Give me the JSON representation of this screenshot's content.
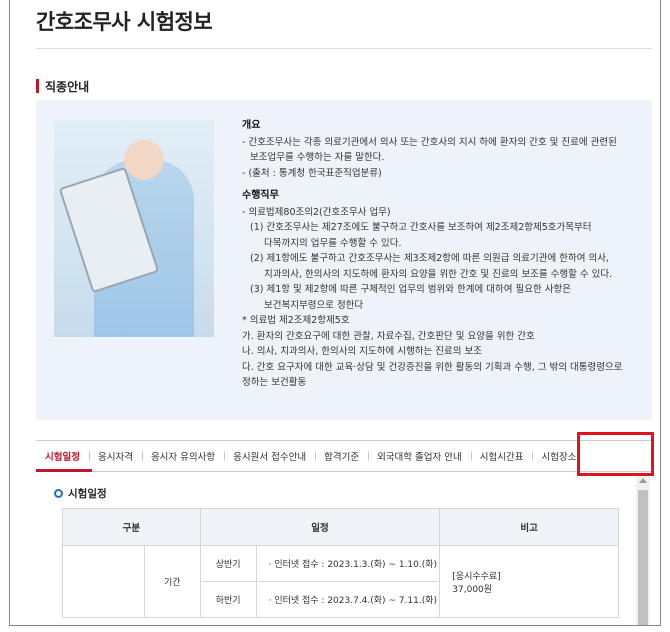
{
  "page": {
    "title": "간호조무사 시험정보"
  },
  "section": {
    "title": "직종안내"
  },
  "info": {
    "overview_heading": "개요",
    "overview_line1": "- 간호조무사는 각종 의료기관에서 의사 또는 간호사의 지시 하에 환자의 간호 및 진료에 관련된",
    "overview_line2": "보조업무를 수행하는 자를 말한다.",
    "source": "- (출처 : 통계청 한국표준직업분류)",
    "duties_heading": "수행직무",
    "law": "- 의료법제80조의2(간호조무사 업무)",
    "d1a": "(1) 간호조무사는 제27조에도 불구하고 간호사를 보조하여 제2조제2항제5호가목부터",
    "d1b": "다목까지의 업무를 수행할 수 있다.",
    "d2a": "(2) 제1항에도 불구하고 간호조무사는 제3조제2항에 따른 의원급 의료기관에 한하여 의사,",
    "d2b": "치과의사, 한의사의 지도하에 환자의 요양을 위한 간호 및 진료의 보조를 수행할 수 있다.",
    "d3a": "(3) 제1항 및 제2항에 따른 구체적인 업무의 범위와 한계에 대하여 필요한 사항은",
    "d3b": "보건복지부령으로 정한다",
    "note": "* 의료법 제2조제2항제5호",
    "na": "가. 환자의 간호요구에 대한 관찰, 자료수집, 간호판단 및 요양을 위한 간호",
    "nb": "나. 의사, 치과의사, 한의사의 지도하에 시행하는 진료의 보조",
    "nc1": "다. 간호 요구자에 대한 교육·상담 및 건강증진을 위한 활동의 기획과 수행, 그 밖의 대통령령으로",
    "nc2": "정하는 보건활동"
  },
  "tabs": [
    "시험일정",
    "응시자격",
    "응시자 유의사항",
    "응시원서 접수안내",
    "합격기준",
    "외국대학 졸업자 안내",
    "시험시간표",
    "시험장소"
  ],
  "schedule": {
    "title": "시험일정",
    "headers": [
      "구분",
      "일정",
      "비고"
    ],
    "period_label": "기간",
    "rows": [
      {
        "half": "상반기",
        "text": "· 인터넷 접수 : 2023.1.3.(화) ~ 1.10.(화)"
      },
      {
        "half": "하반기",
        "text": "· 인터넷 접수 : 2023.7.4.(화) ~ 7.11.(화)"
      }
    ],
    "fee_label": "[응시수수료]",
    "fee_value": "37,000원"
  }
}
